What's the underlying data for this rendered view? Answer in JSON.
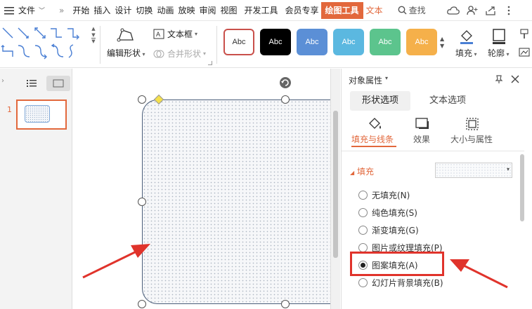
{
  "menubar": {
    "file": "文件",
    "more": "»",
    "tabs": [
      "开始",
      "插入",
      "设计",
      "切换",
      "动画",
      "放映",
      "审阅",
      "视图",
      "开发工具",
      "会员专享"
    ],
    "active_tab": "绘图工具",
    "text_tool_tab": "文本",
    "search": "查找"
  },
  "toolbar": {
    "edit_shape": "编辑形状",
    "text_box": "文本框",
    "merge_shape": "合并形状",
    "style_label": "Abc",
    "fill": "填充",
    "outline": "轮廓"
  },
  "slides": {
    "slide_number": "1"
  },
  "panel": {
    "title": "对象属性",
    "tabs": [
      "形状选项",
      "文本选项"
    ],
    "subtabs": [
      "填充与线条",
      "效果",
      "大小与属性"
    ],
    "section": "填充",
    "options": [
      "无填充(N)",
      "纯色填充(S)",
      "渐变填充(G)",
      "图片或纹理填充(P)",
      "图案填充(A)",
      "幻灯片背景填充(B)"
    ],
    "selected_option": 4
  },
  "colors": {
    "accent": "#e2683c",
    "annotation": "#e0332b",
    "style_fills": [
      "#ffffff",
      "#000000",
      "#5b8fd6",
      "#5bb8e0",
      "#5cc48d",
      "#f5b04a"
    ]
  }
}
